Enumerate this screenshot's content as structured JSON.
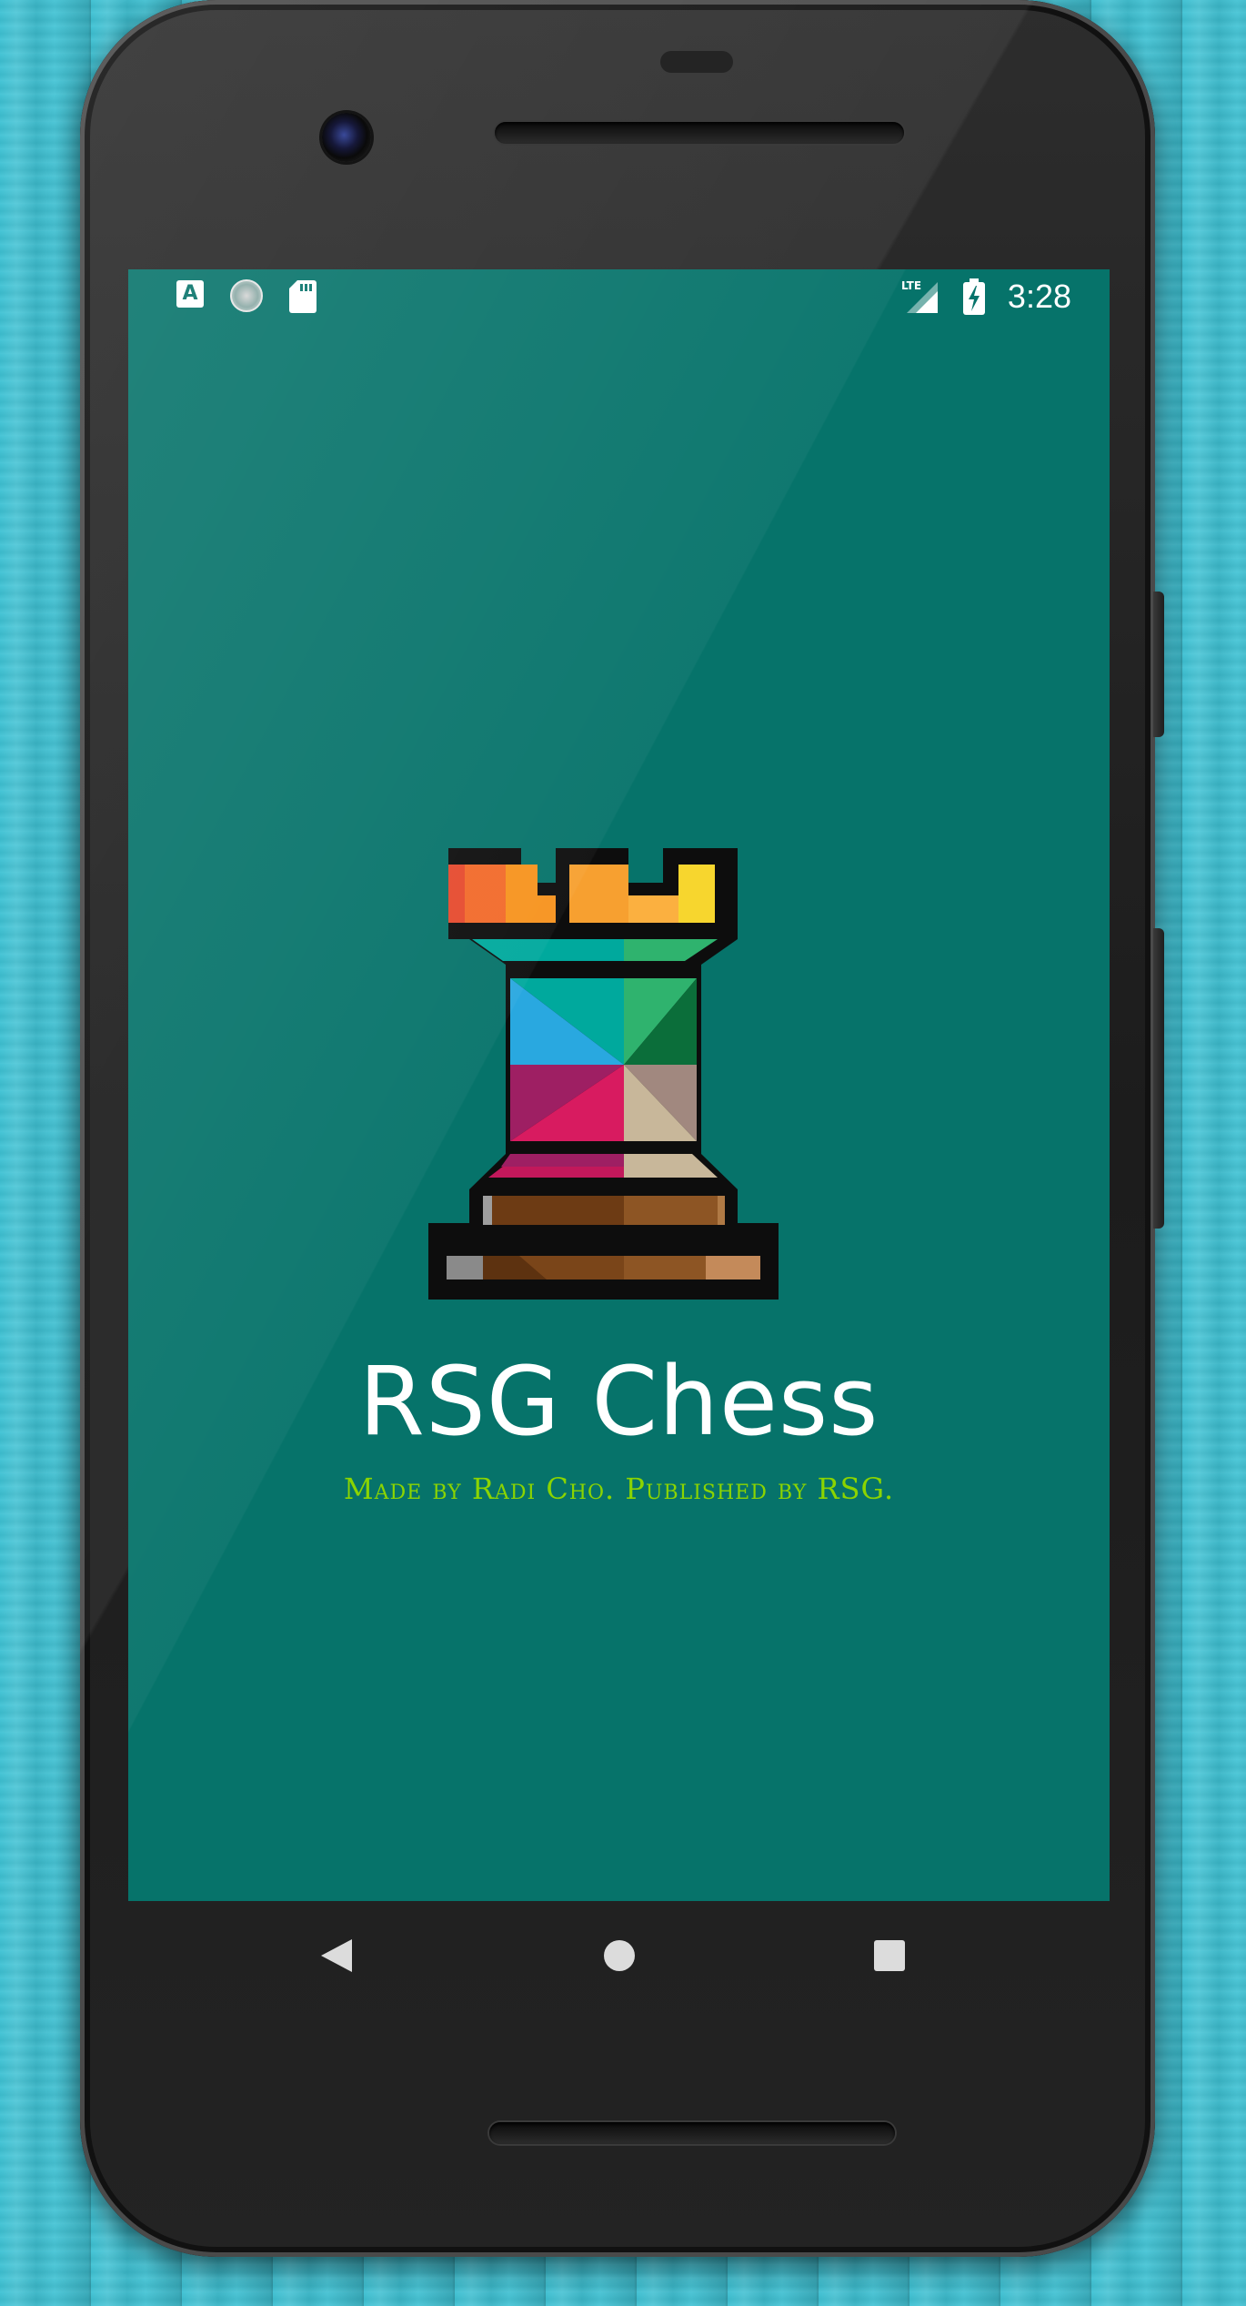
{
  "status_bar": {
    "time": "3:28",
    "network": "LTE",
    "icons": [
      "app-notification-icon",
      "sync-icon",
      "sd-card-icon",
      "lte-signal-icon",
      "battery-charging-icon"
    ]
  },
  "app": {
    "title": "RSG Chess",
    "subtitle": "Made by Radi Cho. Published by RSG.",
    "background_color": "#06736a",
    "subtitle_color": "#8bd400",
    "logo": "rook-chess-piece-icon"
  },
  "navigation": {
    "back": "back-icon",
    "home": "home-icon",
    "recents": "recents-icon"
  },
  "background": {
    "color": "#3ec2d4",
    "texture": "wood-planks"
  }
}
